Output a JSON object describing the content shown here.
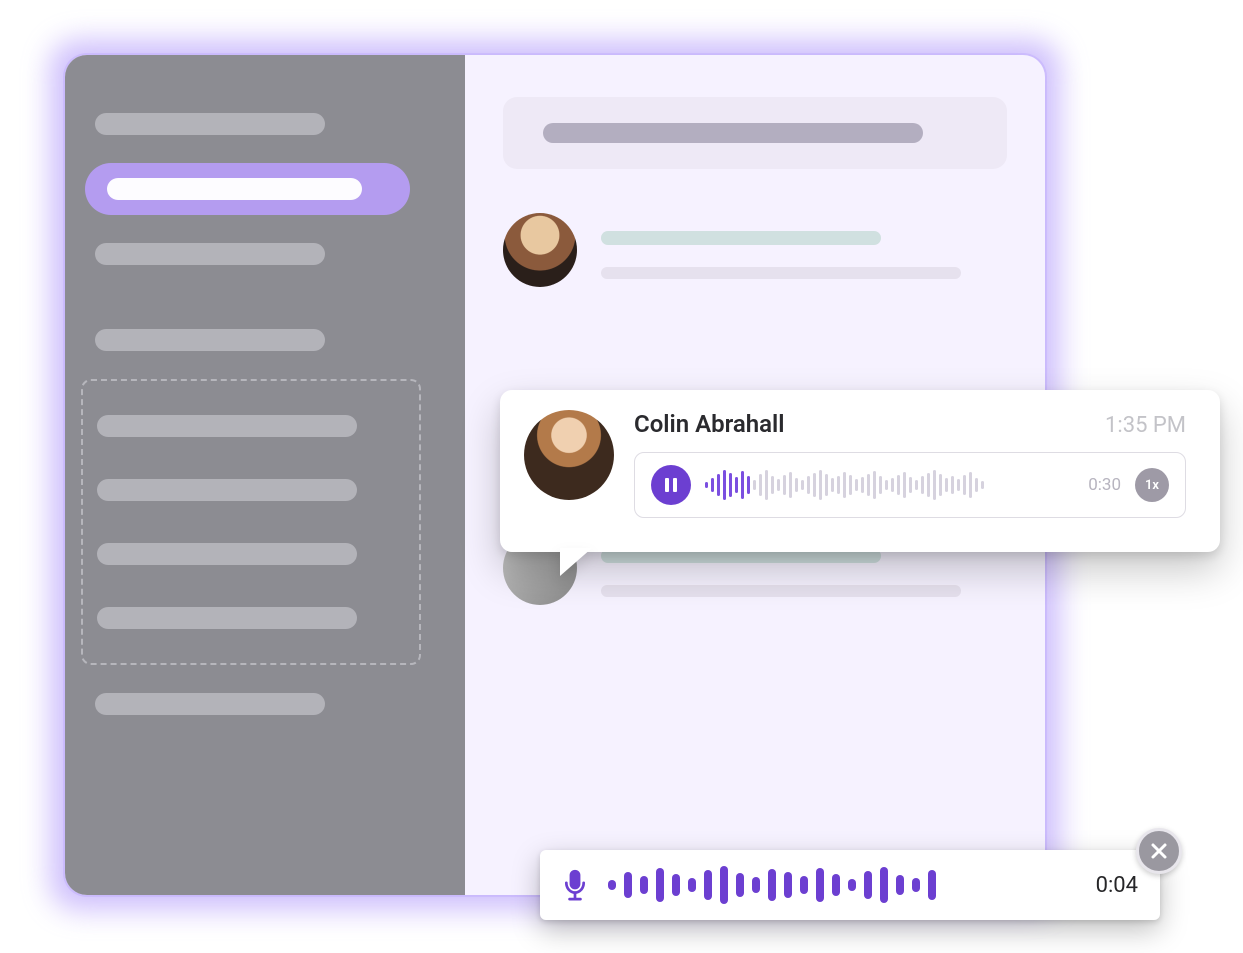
{
  "voice_message": {
    "sender_name": "Colin Abrahall",
    "timestamp": "1:35 PM",
    "duration_label": "0:30",
    "speed_label": "1x",
    "waveform_heights": [
      6,
      14,
      22,
      30,
      24,
      16,
      28,
      18,
      10,
      22,
      30,
      18,
      12,
      20,
      26,
      14,
      10,
      18,
      24,
      30,
      22,
      14,
      18,
      26,
      20,
      12,
      16,
      22,
      28,
      18,
      10,
      14,
      20,
      26,
      16,
      10,
      18,
      24,
      30,
      22,
      14,
      18,
      12,
      20,
      26,
      14,
      8
    ],
    "played_bars": 8
  },
  "recording": {
    "elapsed_label": "0:04",
    "waveform_heights": [
      10,
      26,
      18,
      34,
      22,
      14,
      30,
      38,
      24,
      16,
      32,
      26,
      18,
      34,
      22,
      12,
      28,
      36,
      20,
      14,
      30
    ]
  },
  "colors": {
    "accent": "#6c3fd1",
    "accent_light": "#b49cf0"
  }
}
